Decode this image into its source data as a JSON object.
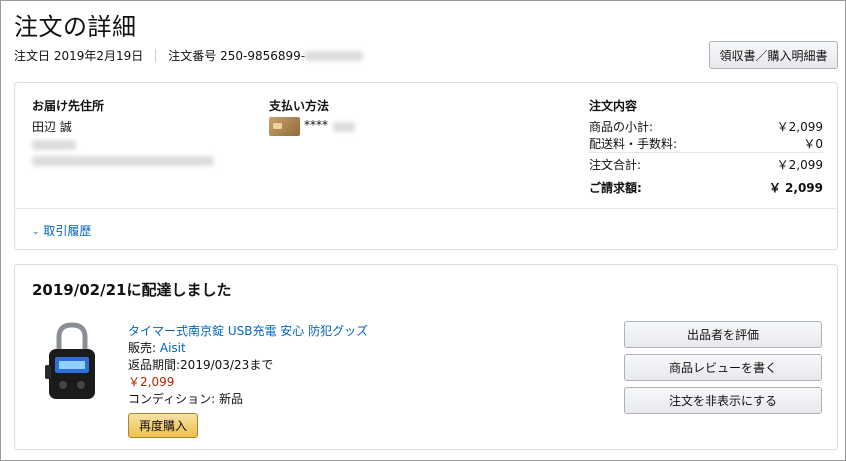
{
  "page": {
    "title": "注文の詳細",
    "order_date_label": "注文日",
    "order_date": "2019年2月19日",
    "order_number_label": "注文番号",
    "order_number": "250-9856899-",
    "receipt_button": "領収書／購入明細書"
  },
  "shipping": {
    "heading": "お届け先住所",
    "name": "田辺 誠"
  },
  "payment": {
    "heading": "支払い方法",
    "card_mask": "****"
  },
  "summary": {
    "heading": "注文内容",
    "rows": [
      {
        "label": "商品の小計:",
        "value": "￥2,099"
      },
      {
        "label": "配送料・手数料:",
        "value": "￥0"
      },
      {
        "label": "注文合計:",
        "value": "￥2,099"
      }
    ],
    "total_label": "ご請求額:",
    "total_value": "￥ 2,099"
  },
  "history_link": "取引履歴",
  "shipment": {
    "status": "2019/02/21に配達しました",
    "product_title": "タイマー式南京錠 USB充電 安心 防犯グッズ",
    "seller_label": "販売:",
    "seller": "Aisit",
    "return_period": "返品期間:2019/03/23まで",
    "price": "￥2,099",
    "condition_label": "コンディション:",
    "condition": "新品",
    "buy_again": "再度購入",
    "actions": [
      "出品者を評価",
      "商品レビューを書く",
      "注文を非表示にする"
    ]
  },
  "colors": {
    "link": "#0066c0",
    "price": "#b12704",
    "buy_again_bg": "#f0c14b"
  }
}
